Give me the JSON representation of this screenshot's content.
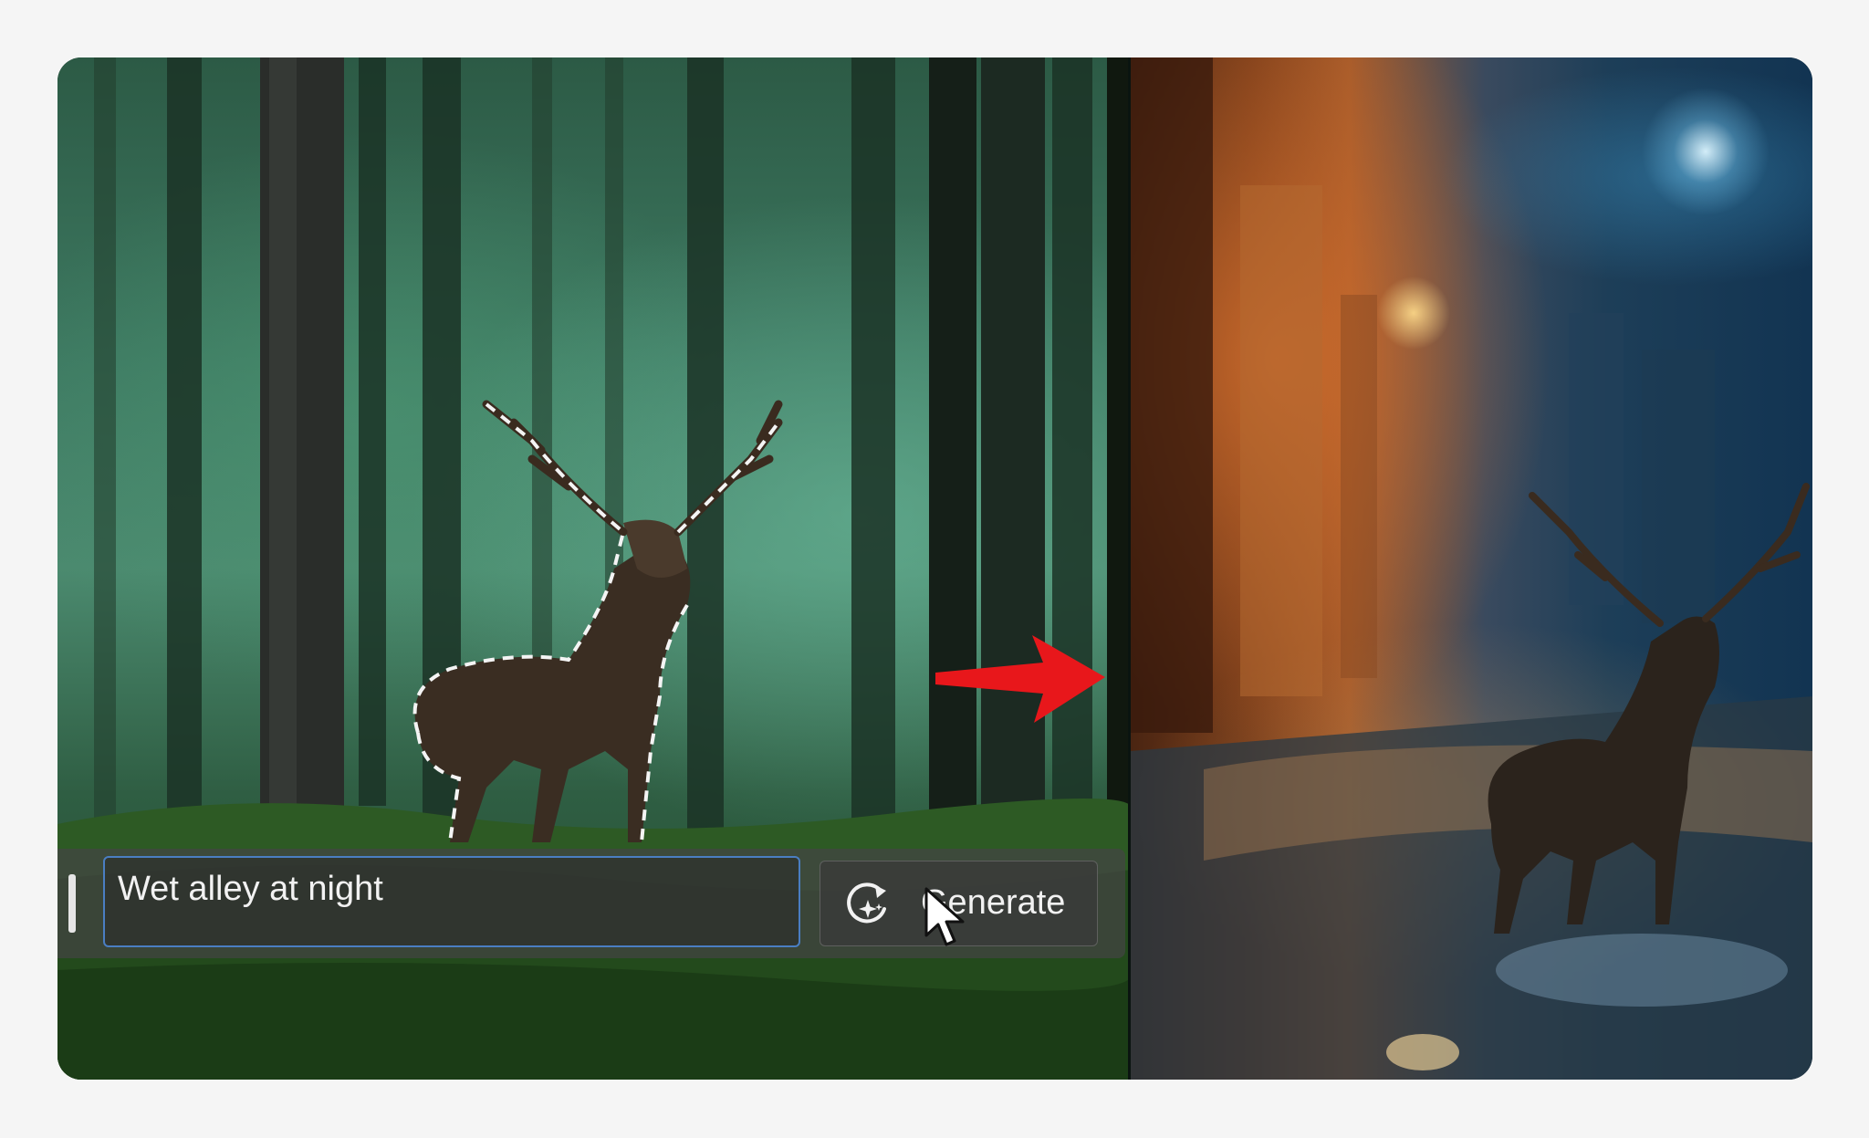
{
  "prompt": {
    "value": "Wet alley at night"
  },
  "generate_button": {
    "label": "Generate",
    "icon": "generate-sparkle-icon"
  },
  "icons": {
    "arrow": "arrow-right-icon",
    "cursor": "mouse-pointer-icon",
    "handle": "drag-handle-icon"
  },
  "colors": {
    "arrow": "#e8171b",
    "input_border": "#4a7ec2",
    "page_background": "#f5f5f5"
  }
}
